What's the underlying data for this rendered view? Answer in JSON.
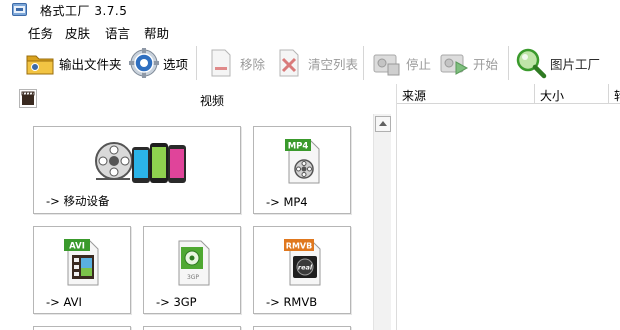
{
  "window": {
    "title": "格式工厂 3.7.5"
  },
  "menu": {
    "items": [
      "任务",
      "皮肤",
      "语言",
      "帮助"
    ]
  },
  "toolbar": {
    "output_folder": "输出文件夹",
    "options": "选项",
    "remove": "移除",
    "clear_list": "清空列表",
    "stop": "停止",
    "start": "开始",
    "picture_factory": "图片工厂"
  },
  "left_panel": {
    "header": "视频",
    "tiles": [
      {
        "label": "-> 移动设备",
        "icon": "film-reel-phones-icon"
      },
      {
        "label": "-> MP4",
        "icon": "mp4-file-icon",
        "badge": "MP4"
      },
      {
        "label": "-> AVI",
        "icon": "avi-file-icon",
        "badge": "AVI"
      },
      {
        "label": "-> 3GP",
        "icon": "3gp-file-icon",
        "badge": "3GP"
      },
      {
        "label": "-> RMVB",
        "icon": "rmvb-file-icon",
        "badge": "RMVB",
        "sub": "real"
      }
    ]
  },
  "task_list": {
    "columns": [
      "来源",
      "大小",
      "转"
    ]
  },
  "colors": {
    "accent_green": "#3a9a2c",
    "disabled_text": "#9a9a9a",
    "tile_border": "#b6b6b6"
  }
}
